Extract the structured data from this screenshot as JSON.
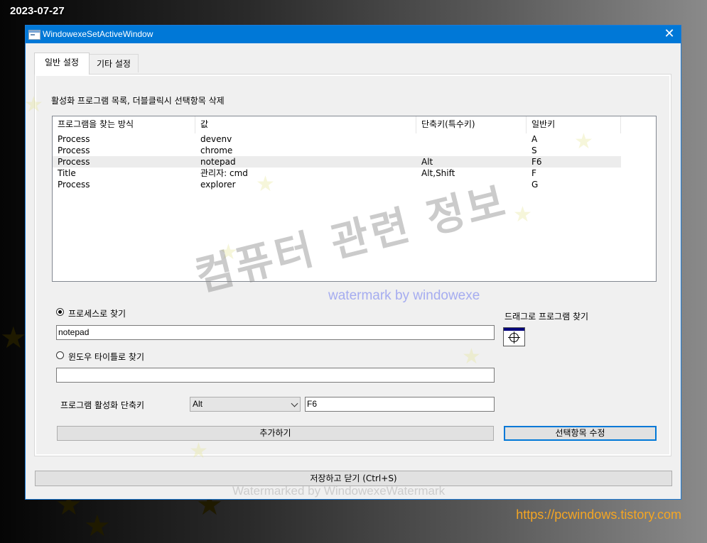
{
  "desktop": {
    "date_stamp": "2023-07-27",
    "site_url": "https://pcwindows.tistory.com",
    "watermark_bottom": "Watermarked by WindowexeWatermark"
  },
  "window": {
    "title": "WindowexeSetActiveWindow",
    "close_glyph": "✕"
  },
  "tabs": [
    {
      "label": "일반 설정",
      "active": true
    },
    {
      "label": "기타 설정",
      "active": false
    }
  ],
  "general": {
    "description": "활성화 프로그램 목록, 더블클릭시 선택항목 삭제",
    "list": {
      "columns": [
        "프로그램을 찾는 방식",
        "값",
        "단축키(특수키)",
        "일반키"
      ],
      "rows": [
        {
          "method": "Process",
          "value": "devenv",
          "modifier": "",
          "key": "A",
          "selected": false
        },
        {
          "method": "Process",
          "value": "chrome",
          "modifier": "",
          "key": "S",
          "selected": false
        },
        {
          "method": "Process",
          "value": "notepad",
          "modifier": "Alt",
          "key": "F6",
          "selected": true
        },
        {
          "method": "Title",
          "value": "관리자: cmd",
          "modifier": "Alt,Shift",
          "key": "F",
          "selected": false
        },
        {
          "method": "Process",
          "value": "explorer",
          "modifier": "",
          "key": "G",
          "selected": false
        }
      ]
    },
    "watermark_main": "컴퓨터 관련 정보",
    "watermark_blue": "watermark by windowexe",
    "radio_process": {
      "label": "프로세스로 찾기",
      "checked": true
    },
    "process_value": "notepad",
    "radio_title": {
      "label": "윈도우 타이틀로 찾기",
      "checked": false
    },
    "title_value": "",
    "drag_label": "드래그로 프로그램 찾기",
    "drag_icon": "crosshair-finder-icon",
    "hotkey_label": "프로그램 활성화 단축키",
    "modifier_selected": "Alt",
    "key_value": "F6",
    "add_button": "추가하기",
    "edit_button": "선택항목 수정"
  },
  "footer": {
    "save_close_button": "저장하고 닫기 (Ctrl+S)"
  }
}
